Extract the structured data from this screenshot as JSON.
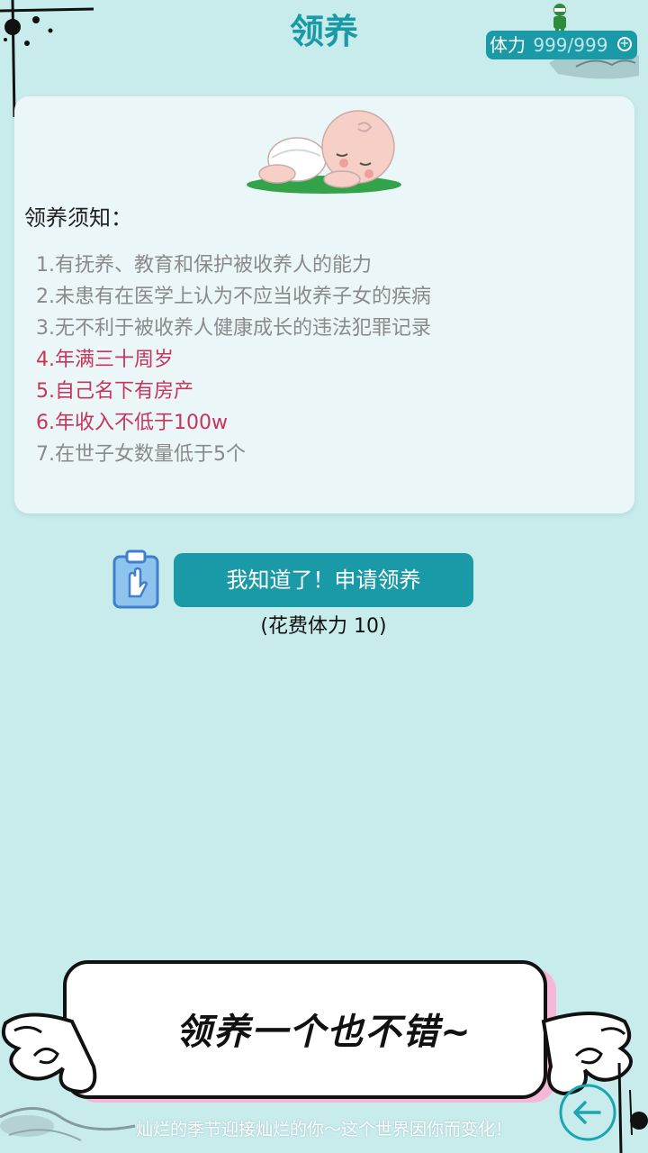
{
  "header": {
    "title": "领养",
    "stamina_label": "体力",
    "stamina_value": "999/999",
    "plus_icon": "+"
  },
  "notice": {
    "title": "领养须知：",
    "rules": [
      {
        "text": "1.有抚养、教育和保护被收养人的能力",
        "highlight": false
      },
      {
        "text": "2.未患有在医学上认为不应当收养子女的疾病",
        "highlight": false
      },
      {
        "text": "3.无不利于被收养人健康成长的违法犯罪记录",
        "highlight": false
      },
      {
        "text": "4.年满三十周岁",
        "highlight": true
      },
      {
        "text": "5.自己名下有房产",
        "highlight": true
      },
      {
        "text": "6.年收入不低于100w",
        "highlight": true
      },
      {
        "text": "7.在世子女数量低于5个",
        "highlight": false
      }
    ]
  },
  "action": {
    "apply_label": "我知道了！申请领养",
    "cost_text": "(花费体力  10)"
  },
  "banner": {
    "text": "领养一个也不错~"
  },
  "footer": {
    "text": "灿烂的季节迎接灿烂的你～这个世界因你而变化！"
  },
  "icons": {
    "baby": "sleeping-baby-icon",
    "clipboard": "clipboard-hand-icon",
    "back": "back-arrow-icon",
    "avatar": "green-figure-icon"
  },
  "colors": {
    "background": "#c8ecec",
    "accent": "#1a9aa6",
    "highlight": "#c8345a",
    "rule_text": "#8a8a8a"
  }
}
